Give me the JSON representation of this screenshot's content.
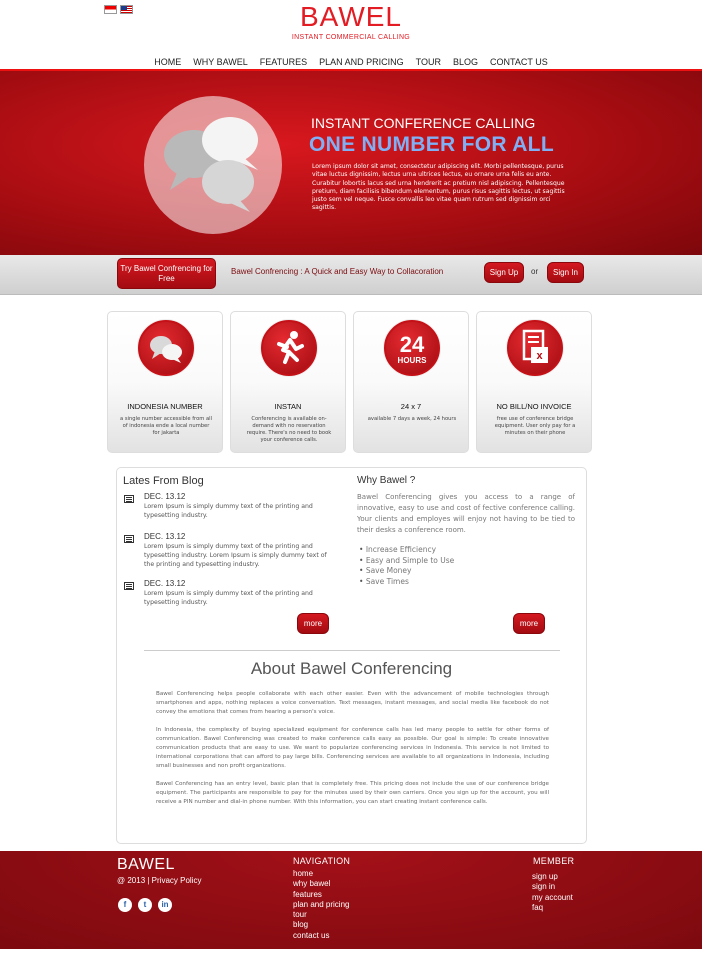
{
  "header": {
    "logo": "BAWEL",
    "tagline": "INSTANT COMMERCIAL CALLING",
    "nav": [
      "HOME",
      "WHY BAWEL",
      "FEATURES",
      "PLAN AND PRICING",
      "TOUR",
      "BLOG",
      "CONTACT US"
    ]
  },
  "hero": {
    "title": "INSTANT CONFERENCE CALLING",
    "headline": "ONE NUMBER FOR ALL",
    "body": "Lorem ipsum dolor sit amet, consectetur adipiscing elit. Morbi pellentesque, purus vitae luctus dignissim, lectus urna ultrices lectus, eu ornare urna felis eu ante. Curabitur lobortis lacus sed urna hendrerit ac pretium nisl adipiscing. Pellentesque pretium, diam facilisis bibendum elementum, purus risus sagittis lectus, ut sagittis justo sem vel neque. Fusce convallis leo vitae quam rutrum sed dignissim orci sagittis."
  },
  "cta": {
    "try_button": "Try Bawel Confrencing for Free",
    "tagline": "Bawel Confrencing : A Quick and Easy Way to Collacoration",
    "signup": "Sign Up",
    "or": "or",
    "signin": "Sign In"
  },
  "features": [
    {
      "title": "INDONESIA NUMBER",
      "desc": "a single number accessible from all of indonesia ende a local number for jakarta",
      "icon": "chat-bubbles-icon"
    },
    {
      "title": "INSTAN",
      "desc": "Conferencing is available on-demand with no reservation require. There's no need to book your conference calls.",
      "icon": "running-man-icon"
    },
    {
      "title": "24 x 7",
      "desc": "available 7 days a week, 24 hours",
      "icon": "24-hours-icon",
      "icon_big": "24",
      "icon_small": "HOURS"
    },
    {
      "title": "NO BILL/NO INVOICE",
      "desc": "free use of conference bridge equipment. User only pay for a minutes on their phone",
      "icon": "receipt-icon"
    }
  ],
  "blog": {
    "title": "Lates From Blog",
    "items": [
      {
        "date": "DEC. 13.12",
        "text": "Lorem Ipsum is simply dummy text of the printing and typesetting industry."
      },
      {
        "date": "DEC. 13.12",
        "text": "Lorem Ipsum is simply dummy text of the printing and typesetting industry. Lorem Ipsum is simply dummy text of the printing and typesetting industry."
      },
      {
        "date": "DEC. 13.12",
        "text": "Lorem Ipsum is simply dummy text of the printing and typesetting industry."
      }
    ],
    "more": "more"
  },
  "why": {
    "title": "Why Bawel ?",
    "body": "Bawel Conferencing gives you access to a range of innovative, easy to use and cost of fective conference calling. Your clients and employes will enjoy not having to be tied to their desks a conference room.",
    "points": [
      "Increase Efficiency",
      "Easy and Simple to Use",
      "Save Money",
      "Save Times"
    ],
    "more": "more"
  },
  "about": {
    "title": "About Bawel Conferencing",
    "paragraphs": [
      "Bawel Conferencing helps people collaborate with each other easier. Even with the advancement of mobile technologies through smartphones and apps, nothing replaces a voice conversation. Text messages, instant messages, and social media like facebook do not convey the emotions that comes from hearing a person's voice.",
      "In Indonesia, the complexity of buying specialized equipment for conference calls has led many people to settle for other forms of communication. Bawel Conferencing was created to make conference calls easy as possible. Our goal is simple: To create innovative communication products that are easy to use. We want to popularize conferencing services in Indonesia. This service is not limited to international corporations that can afford to pay large bills. Conferencing services are available to all organizations in Indonesia, including small businesses and non profit organizations.",
      "Bawel Conferencing has an entry level, basic plan that is completely free. This pricing does not include the use of our conference bridge equipment. The participants are responsible to pay for the minutes used by their own carriers. Once you sign up for the account, you will receive a PIN number and dial-in phone number. With this information, you can start creating instant conference calls."
    ]
  },
  "footer": {
    "brand": "BAWEL",
    "copyright": "@ 2013 | Privacy Policy",
    "nav_title": "NAVIGATION",
    "nav_links": [
      "home",
      "why bawel",
      "features",
      "plan and pricing",
      "tour",
      "blog",
      "contact us"
    ],
    "member_title": "MEMBER",
    "member_links": [
      "sign up",
      "sign in",
      "my account",
      "faq"
    ],
    "social": [
      "f",
      "t",
      "in"
    ]
  },
  "colors": {
    "brand_red": "#e31b23",
    "dark_red": "#8a0a10",
    "headline_blue": "#7fb0f5"
  }
}
